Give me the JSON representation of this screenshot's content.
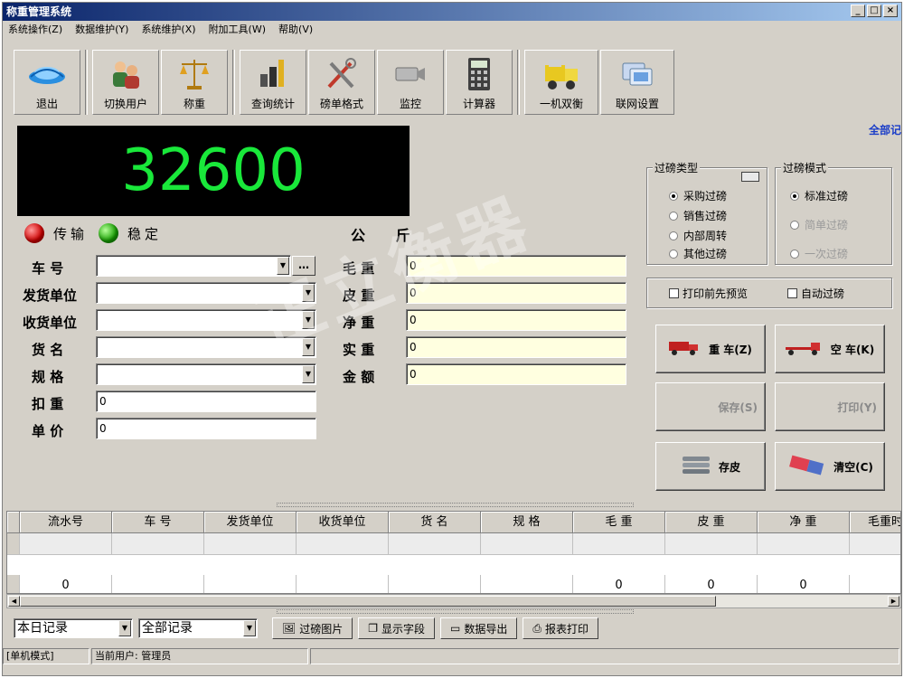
{
  "window": {
    "title": "称重管理系统",
    "min": "_",
    "max": "□",
    "close": "×"
  },
  "menu": [
    "系统操作(Z)",
    "数据维护(Y)",
    "系统维护(X)",
    "附加工具(W)",
    "帮助(V)"
  ],
  "toolbar": [
    {
      "label": "退出",
      "icon": "exit-icon"
    },
    {
      "label": "切换用户",
      "icon": "users-icon"
    },
    {
      "label": "称重",
      "icon": "scale-icon"
    },
    {
      "label": "查询统计",
      "icon": "stats-icon"
    },
    {
      "label": "磅单格式",
      "icon": "tools-icon"
    },
    {
      "label": "监控",
      "icon": "camera-icon"
    },
    {
      "label": "计算器",
      "icon": "calculator-icon"
    },
    {
      "label": "一机双衡",
      "icon": "truck-icon"
    },
    {
      "label": "联网设置",
      "icon": "network-icon"
    }
  ],
  "top_right_link": "全部记",
  "display": {
    "weight": "32600",
    "transfer_label": "传输",
    "stable_label": "稳定",
    "unit": "公 斤"
  },
  "form": {
    "car_label": "车 号",
    "sender_label": "发货单位",
    "receiver_label": "收货单位",
    "goods_label": "货 名",
    "spec_label": "规 格",
    "deduct_label": "扣 重",
    "price_label": "单 价",
    "deduct_value": "0",
    "price_value": "0",
    "dots": "…"
  },
  "weights": {
    "gross_label": "毛 重",
    "gross_value": "0",
    "tare_label": "皮 重",
    "tare_value": "0",
    "net_label": "净 重",
    "net_value": "0",
    "actual_label": "实 重",
    "actual_value": "0",
    "amount_label": "金 额",
    "amount_value": "0"
  },
  "weigh_type": {
    "legend": "过磅类型",
    "options": [
      "采购过磅",
      "销售过磅",
      "内部周转",
      "其他过磅"
    ],
    "selected": 0
  },
  "weigh_mode": {
    "legend": "过磅模式",
    "options": [
      "标准过磅",
      "简单过磅",
      "一次过磅"
    ],
    "selected": 0
  },
  "checks": {
    "print_preview": "打印前先预览",
    "auto_weigh": "自动过磅"
  },
  "buttons": {
    "heavy": "重 车(Z)",
    "empty": "空 车(K)",
    "save": "保存(S)",
    "print": "打印(Y)",
    "store_tare": "存皮",
    "clear": "清空(C)"
  },
  "table": {
    "headers": [
      "流水号",
      "车 号",
      "发货单位",
      "收货单位",
      "货 名",
      "规 格",
      "毛 重",
      "皮 重",
      "净 重",
      "毛重时"
    ],
    "total_row": [
      "0",
      "",
      "",
      "",
      "",
      "",
      "0",
      "0",
      "0",
      ""
    ]
  },
  "bottom": {
    "range": "本日记录",
    "filter": "全部记录",
    "pic_btn": "过磅图片",
    "field_btn": "显示字段",
    "export_btn": "数据导出",
    "report_btn": "报表打印"
  },
  "status": {
    "mode": "[单机模式]",
    "user": "当前用户: 管理员"
  },
  "watermark": "正立衡器"
}
